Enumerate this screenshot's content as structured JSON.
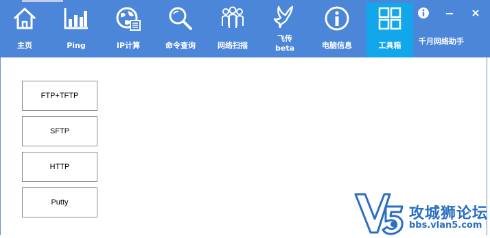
{
  "toolbar": {
    "items": [
      {
        "label": "主页",
        "icon": "home-icon"
      },
      {
        "label": "Ping",
        "icon": "bar-chart-icon"
      },
      {
        "label": "IP计算",
        "icon": "globe-icon"
      },
      {
        "label": "命令查询",
        "icon": "magnifier-icon"
      },
      {
        "label": "网络扫描",
        "icon": "people-icon"
      },
      {
        "label": "飞传\nbeta",
        "label_line1": "飞传",
        "label_line2": "beta",
        "icon": "dove-icon"
      },
      {
        "label": "电脑信息",
        "icon": "info-icon"
      },
      {
        "label": "工具箱",
        "icon": "grid-icon"
      }
    ],
    "active": "工具箱"
  },
  "window": {
    "title": "千月网络助手",
    "controls": {
      "info": "info-icon",
      "minimize": "minimize-icon",
      "close": "close-icon"
    }
  },
  "tools": {
    "buttons": [
      "FTP+TFTP",
      "SFTP",
      "HTTP",
      "Putty"
    ]
  },
  "watermark": {
    "brand": "攻城狮论坛",
    "url": "bbs.vlan5.com"
  },
  "colors": {
    "toolbar_bg": "#4b86d8",
    "active_tab_bg": "#12a6eb",
    "watermark_blue": "#2a6fc0"
  }
}
